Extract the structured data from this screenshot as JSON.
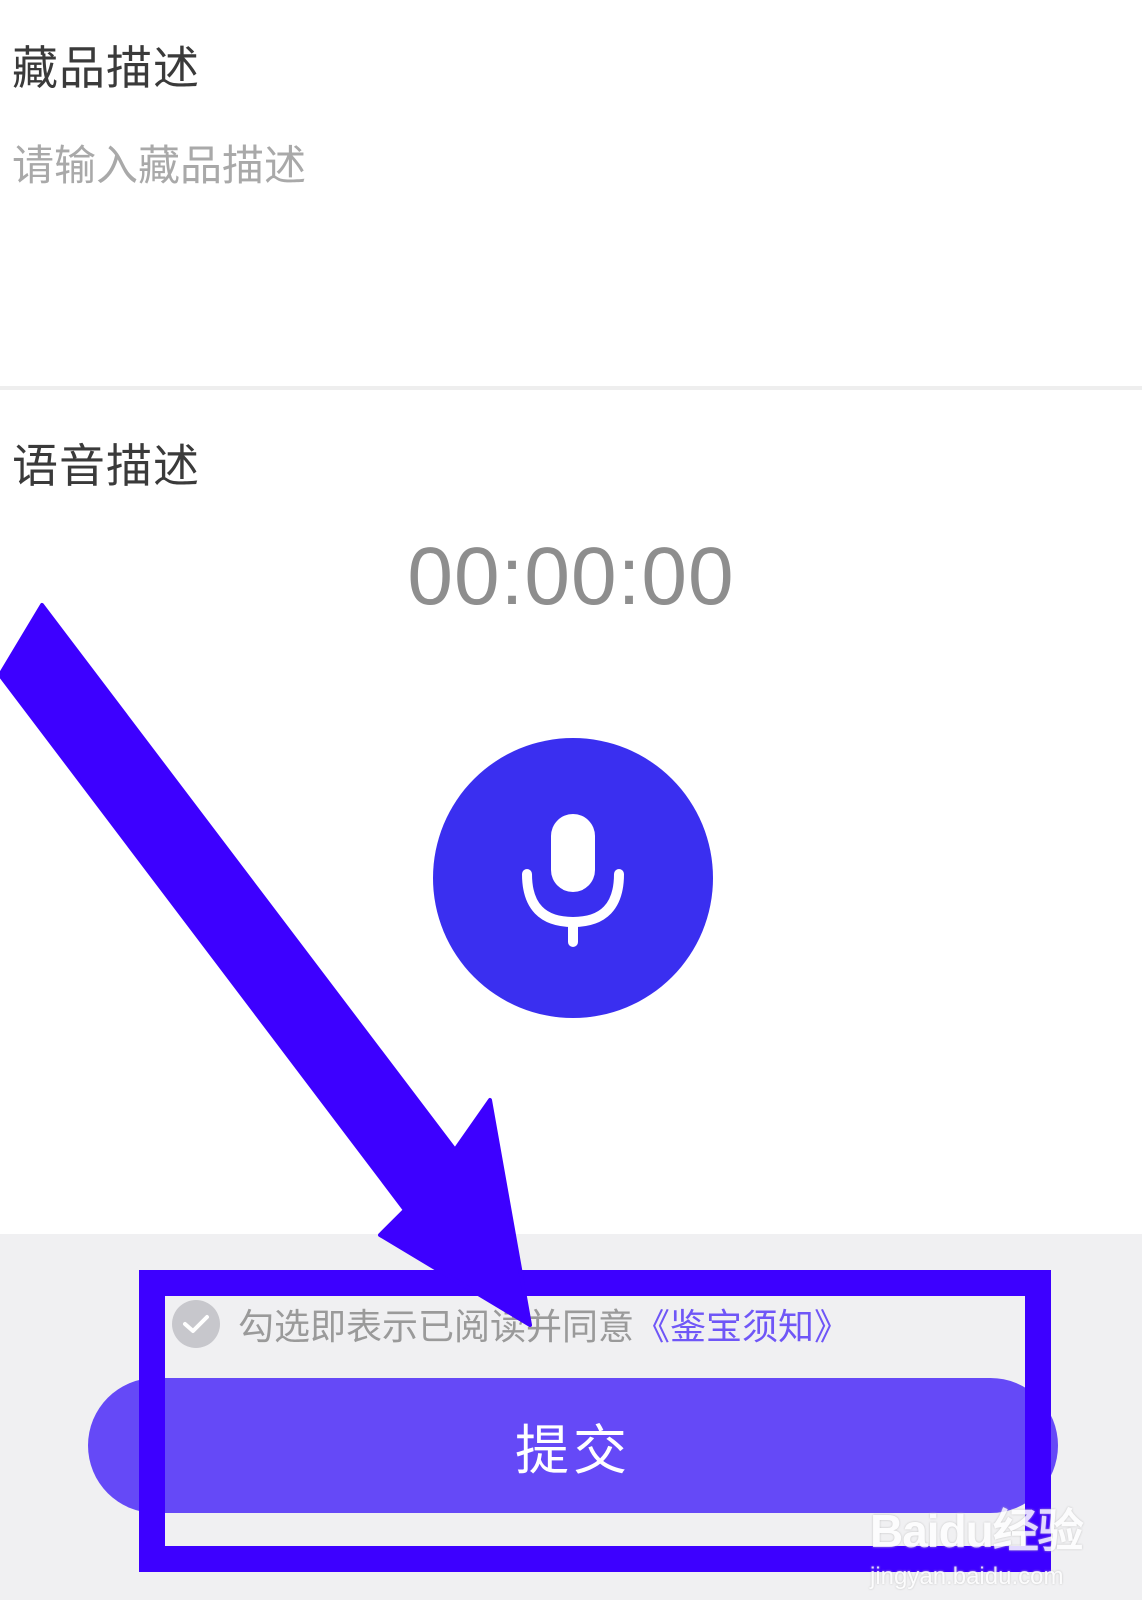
{
  "description": {
    "title": "藏品描述",
    "placeholder": "请输入藏品描述",
    "value": ""
  },
  "voice": {
    "title": "语音描述",
    "timer": "00:00:00",
    "mic_icon": "microphone-icon",
    "button_color": "#3a2ff0"
  },
  "agreement": {
    "checked": false,
    "text": "勾选即表示已阅读并同意",
    "link": "《鉴宝须知》",
    "link_color": "#6f56f7"
  },
  "submit": {
    "label": "提交",
    "color": "#6549f7"
  },
  "annotation": {
    "color": "#3d00ff"
  },
  "watermark": {
    "brand": "Baidu经验",
    "url": "jingyan.baidu.com"
  }
}
